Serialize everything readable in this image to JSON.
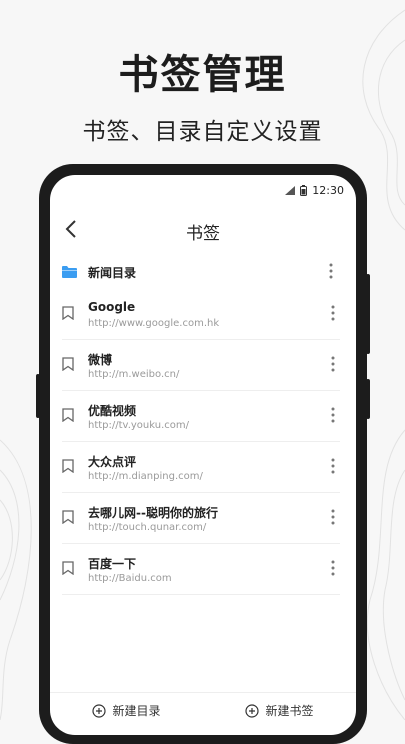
{
  "promo": {
    "title": "书签管理",
    "subtitle": "书签、目录自定义设置"
  },
  "status_bar": {
    "time": "12:30",
    "icons": [
      "signal-icon",
      "battery-icon"
    ]
  },
  "nav": {
    "back_icon": "chevron-left-icon",
    "title": "书签"
  },
  "folder": {
    "icon": "folder-icon",
    "icon_color": "#3b9df1",
    "name": "新闻目录"
  },
  "bookmarks": [
    {
      "title": "Google",
      "url": "http://www.google.com.hk"
    },
    {
      "title": "微博",
      "url": "http://m.weibo.cn/"
    },
    {
      "title": "优酷视频",
      "url": "http://tv.youku.com/"
    },
    {
      "title": "大众点评",
      "url": "http://m.dianping.com/"
    },
    {
      "title": "去哪儿网--聪明你的旅行",
      "url": "http://touch.qunar.com/"
    },
    {
      "title": "百度一下",
      "url": "http://Baidu.com"
    }
  ],
  "bottom_bar": {
    "new_folder_label": "新建目录",
    "new_bookmark_label": "新建书签"
  }
}
